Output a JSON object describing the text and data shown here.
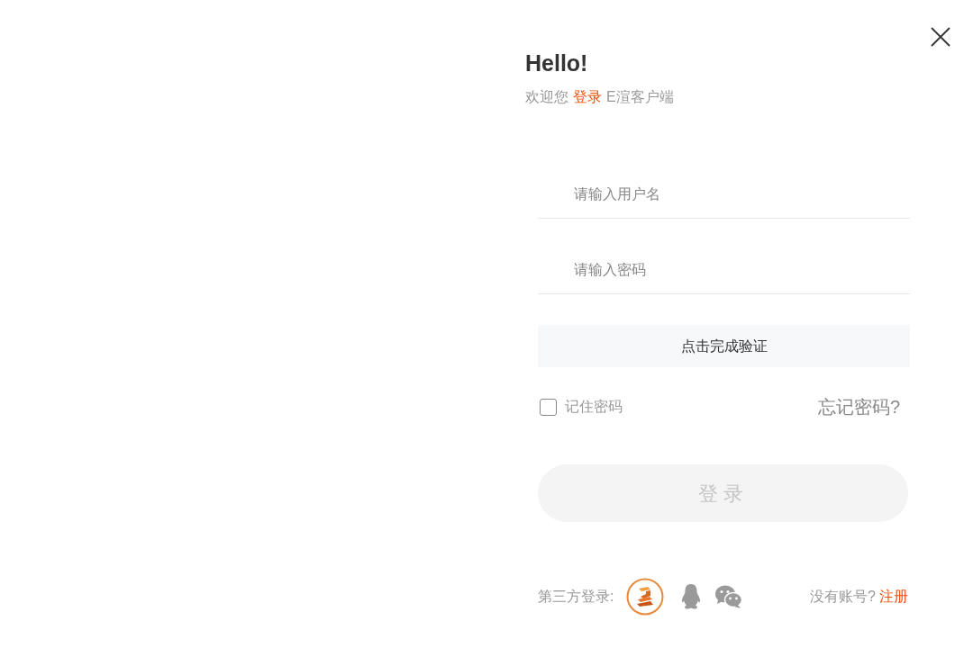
{
  "header": {
    "title": "Hello!",
    "subtitle": {
      "before": "欢迎您",
      "link": "登录",
      "after": "E渲客户端"
    }
  },
  "form": {
    "username": {
      "placeholder": "请输入用户名"
    },
    "password": {
      "placeholder": "请输入密码"
    },
    "captcha": {
      "label": "点击完成验证"
    },
    "remember": {
      "label": "记住密码",
      "checked": false
    },
    "forgot_password": "忘记密码?",
    "login_button": {
      "label": "登录",
      "disabled": true
    }
  },
  "footer": {
    "third_party_label": "第三方登录:",
    "signup_prompt": "没有账号?",
    "signup_link": "注册"
  }
}
